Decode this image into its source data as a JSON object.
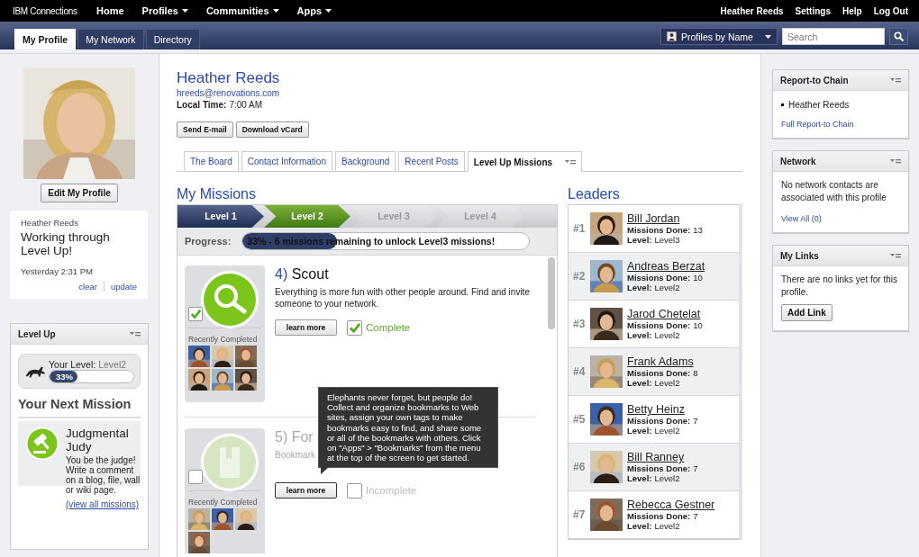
{
  "top_nav": {
    "logo": "IBM Connections",
    "items": [
      {
        "label": "Home",
        "dropdown": false
      },
      {
        "label": "Profiles",
        "dropdown": true
      },
      {
        "label": "Communities",
        "dropdown": true
      },
      {
        "label": "Apps",
        "dropdown": true
      }
    ],
    "user_links": [
      "Heather Reeds",
      "Settings",
      "Help",
      "Log Out"
    ]
  },
  "sub_nav": {
    "tabs": [
      {
        "label": "My Profile",
        "selected": true
      },
      {
        "label": "My Network",
        "selected": false
      },
      {
        "label": "Directory",
        "selected": false
      }
    ],
    "scope": "Profiles by Name",
    "search": {
      "placeholder": "Search"
    }
  },
  "profile_card": {
    "edit_button": "Edit My Profile",
    "status": {
      "author": "Heather Reeds",
      "message": "Working through Level Up!",
      "time": "Yesterday 2:31 PM",
      "actions": [
        "clear",
        "update"
      ]
    }
  },
  "level_up_widget": {
    "title": "Level Up",
    "level_label": "Your Level:",
    "level_value": "Level2",
    "level": 0.33,
    "percent": "33%",
    "next_heading": "Your Next Mission",
    "next_mission": {
      "title": "Judgmental Judy",
      "description": "You be the judge! Write a comment on a blog, file, wall or wiki page.",
      "link": "(view all missions)"
    }
  },
  "profile": {
    "name": "Heather Reeds",
    "email": "hreeds@renovations.com",
    "local_time_label": "Local Time:",
    "local_time": "7:00 AM",
    "buttons": [
      "Send E-mail",
      "Download vCard"
    ]
  },
  "profile_tabs": [
    {
      "label": "The Board",
      "selected": false
    },
    {
      "label": "Contact Information",
      "selected": false
    },
    {
      "label": "Background",
      "selected": false
    },
    {
      "label": "Recent Posts",
      "selected": false
    },
    {
      "label": "Level Up Missions",
      "selected": true
    }
  ],
  "missions_heading": "My Missions",
  "levels": [
    {
      "label": "Level 1",
      "completed": true,
      "selected": false
    },
    {
      "label": "Level 2",
      "selected": true
    },
    {
      "label": "Level 3",
      "completed": false,
      "selected": false
    },
    {
      "label": "Level 4",
      "completed": false,
      "selected": false
    }
  ],
  "progress": {
    "label": "Progress:",
    "level": 0.33,
    "text": "33% - 6 missions remaining to unlock Level3 missions!"
  },
  "missions": [
    {
      "kind": "search",
      "title": "4) Scout",
      "description": "Everything is more fun with other people around. Find and invite someone to your network.",
      "complete": true,
      "recent_label": "Recently Completed",
      "button": "learn more",
      "status": "Complete"
    },
    {
      "kind": "bookmark",
      "title": "5) For",
      "description": "Bookmark",
      "complete": false,
      "recent_label": "Recently Completed",
      "button": "learn more",
      "status": "Incomplete"
    }
  ],
  "tooltip": {
    "text": "Elephants never forget, but people do! Collect and organize bookmarks to Web sites, assign your own tags to make bookmarks easy to find, and share some or all of the bookmarks with others. Click on \"Apps\" > \"Bookmarks\" from the menu at the top of the screen to get started."
  },
  "leaders_heading": "Leaders",
  "leaders": [
    {
      "rank": "#1",
      "name": "Bill Jordan",
      "missions_label": "Missions Done:",
      "missions": "13",
      "level_label": "Level:",
      "level_name": "Level3"
    },
    {
      "rank": "#2",
      "name": "Andreas Berzat",
      "missions_label": "Missions Done:",
      "missions": "10",
      "level_label": "Level:",
      "level_name": "Level2"
    },
    {
      "rank": "#3",
      "name": "Jarod Chetelat",
      "missions_label": "Missions Done:",
      "missions": "10",
      "level_label": "Level:",
      "level_name": "Level2"
    },
    {
      "rank": "#4",
      "name": "Frank Adams",
      "missions_label": "Missions Done:",
      "missions": "8",
      "level_label": "Level:",
      "level_name": "Level2"
    },
    {
      "rank": "#5",
      "name": "Betty Heinz",
      "missions_label": "Missions Done:",
      "missions": "7",
      "level_label": "Level:",
      "level_name": "Level2"
    },
    {
      "rank": "#6",
      "name": "Bill Ranney",
      "missions_label": "Missions Done:",
      "missions": "7",
      "level_label": "Level:",
      "level_name": "Level2"
    },
    {
      "rank": "#7",
      "name": "Rebecca Gestner",
      "missions_label": "Missions Done:",
      "missions": "7",
      "level_label": "Level:",
      "level_name": "Level2"
    }
  ],
  "right_widgets": [
    {
      "kind": "chain",
      "title": "Report-to Chain",
      "items": [
        "Heather Reeds"
      ],
      "link": "Full Report-to Chain"
    },
    {
      "kind": "text",
      "title": "Network",
      "text": "No network contacts are associated with this profile",
      "link": "View All (0)"
    },
    {
      "kind": "text",
      "title": "My Links",
      "text": "There are no links yet for this profile.",
      "button": "Add Link"
    }
  ]
}
